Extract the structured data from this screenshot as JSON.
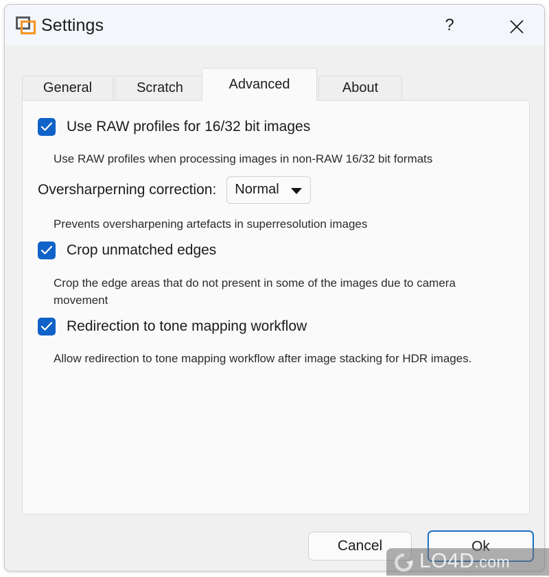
{
  "window": {
    "title": "Settings",
    "icon": "app-window-icon",
    "help_label": "?",
    "close_label": "close-icon",
    "accent_blue": "#0f62c8",
    "icon_orange": "#f79420",
    "title_bar_bg": "#f3f6fa",
    "window_bg": "#f0f0f0",
    "panel_bg": "#fafafa"
  },
  "tabs": [
    {
      "id": "general",
      "label": "General",
      "active": false
    },
    {
      "id": "scratch",
      "label": "Scratch",
      "active": false
    },
    {
      "id": "advanced",
      "label": "Advanced",
      "active": true
    },
    {
      "id": "about",
      "label": "About",
      "active": false
    }
  ],
  "settings": {
    "raw_profiles": {
      "label": "Use RAW profiles for  16/32 bit images",
      "description": "Use RAW profiles when processing images in non-RAW 16/32 bit formats",
      "checked": true
    },
    "oversharpening": {
      "label": "Oversharperning correction:",
      "value": "Normal",
      "options": [
        "Normal"
      ],
      "description": "Prevents oversharpening artefacts in superresolution images"
    },
    "crop_edges": {
      "label": "Crop unmatched edges",
      "description": "Crop the edge areas that do not present in some of the images due to camera movement",
      "checked": true
    },
    "tone_mapping": {
      "label": "Redirection to tone mapping workflow",
      "description": "Allow redirection to tone mapping workflow after image stacking for HDR images.",
      "checked": true
    }
  },
  "footer": {
    "cancel_label": "Cancel",
    "ok_label": "Ok"
  },
  "watermark": {
    "text": "LO4D",
    "suffix": ".com"
  }
}
